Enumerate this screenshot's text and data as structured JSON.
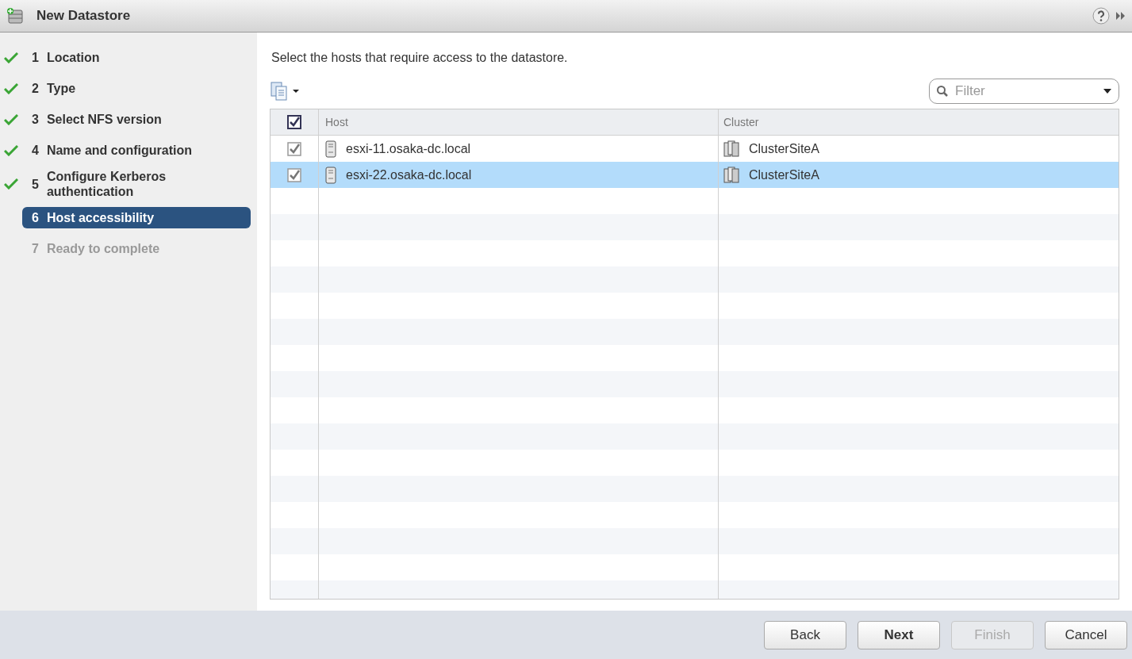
{
  "window": {
    "title": "New Datastore"
  },
  "steps": [
    {
      "number": "1",
      "label": "Location",
      "completed": true,
      "selected": false,
      "disabled": false
    },
    {
      "number": "2",
      "label": "Type",
      "completed": true,
      "selected": false,
      "disabled": false
    },
    {
      "number": "3",
      "label": "Select NFS version",
      "completed": true,
      "selected": false,
      "disabled": false
    },
    {
      "number": "4",
      "label": "Name and configuration",
      "completed": true,
      "selected": false,
      "disabled": false
    },
    {
      "number": "5",
      "label": "Configure Kerberos authentication",
      "completed": true,
      "selected": false,
      "disabled": false
    },
    {
      "number": "6",
      "label": "Host accessibility",
      "completed": false,
      "selected": true,
      "disabled": false
    },
    {
      "number": "7",
      "label": "Ready to complete",
      "completed": false,
      "selected": false,
      "disabled": true
    }
  ],
  "instruction": "Select the hosts that require access to the datastore.",
  "filter": {
    "placeholder": "Filter"
  },
  "table": {
    "select_all_checked": true,
    "columns": [
      "Host",
      "Cluster"
    ],
    "rows": [
      {
        "checked": true,
        "selected": false,
        "host": "esxi-11.osaka-dc.local",
        "cluster": "ClusterSiteA"
      },
      {
        "checked": true,
        "selected": true,
        "host": "esxi-22.osaka-dc.local",
        "cluster": "ClusterSiteA"
      }
    ]
  },
  "buttons": [
    {
      "label": "Back",
      "primary": false,
      "disabled": false
    },
    {
      "label": "Next",
      "primary": true,
      "disabled": false
    },
    {
      "label": "Finish",
      "primary": false,
      "disabled": true
    },
    {
      "label": "Cancel",
      "primary": false,
      "disabled": false
    }
  ]
}
